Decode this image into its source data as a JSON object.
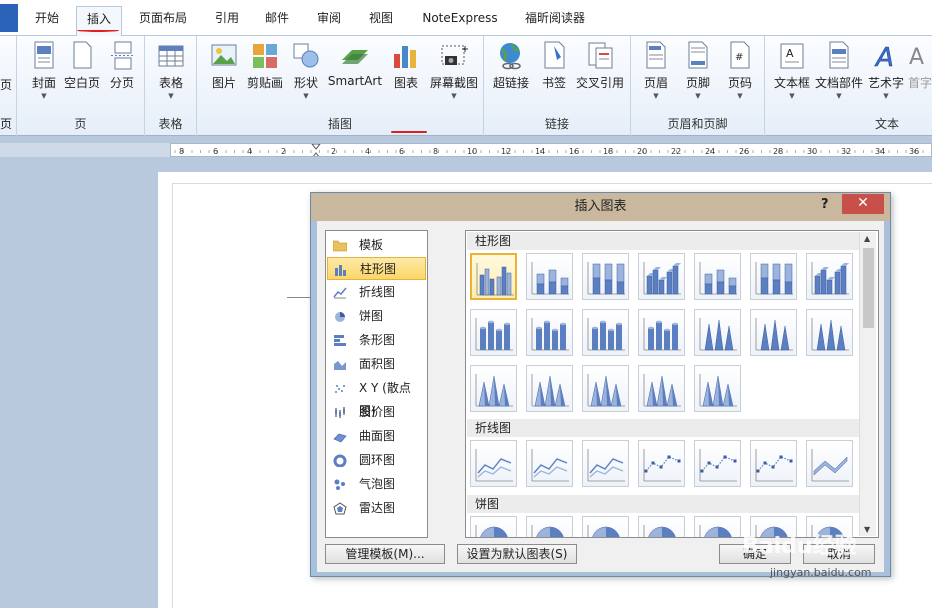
{
  "tabs": {
    "file_label": "",
    "items": [
      "开始",
      "插入",
      "页面布局",
      "引用",
      "邮件",
      "审阅",
      "视图",
      "NoteExpress",
      "福昕阅读器"
    ],
    "active": "插入"
  },
  "ribbon": {
    "left_edge_labels": [
      "页",
      "页"
    ],
    "groups": [
      {
        "label": "页",
        "buttons": [
          "封面",
          "空白页",
          "分页"
        ]
      },
      {
        "label": "表格",
        "buttons": [
          "表格"
        ]
      },
      {
        "label": "插图",
        "buttons": [
          "图片",
          "剪贴画",
          "形状",
          "SmartArt",
          "图表",
          "屏幕截图"
        ]
      },
      {
        "label": "链接",
        "buttons": [
          "超链接",
          "书签",
          "交叉引用"
        ]
      },
      {
        "label": "页眉和页脚",
        "buttons": [
          "页眉",
          "页脚",
          "页码"
        ]
      },
      {
        "label": "文本",
        "buttons": [
          "文本框",
          "文档部件",
          "艺术字",
          "首字"
        ]
      }
    ]
  },
  "ruler": {
    "ticks": [
      "8",
      "6",
      "4",
      "2",
      "2",
      "4",
      "6",
      "8",
      "10",
      "12",
      "14",
      "16",
      "18",
      "20",
      "22",
      "24",
      "26",
      "28",
      "30",
      "32",
      "34",
      "36"
    ]
  },
  "dialog": {
    "title": "插入图表",
    "help": "?",
    "close": "✕",
    "categories": [
      "模板",
      "柱形图",
      "折线图",
      "饼图",
      "条形图",
      "面积图",
      "X Y (散点图)",
      "股价图",
      "曲面图",
      "圆环图",
      "气泡图",
      "雷达图"
    ],
    "selected_category": "柱形图",
    "sections": [
      "柱形图",
      "折线图",
      "饼图"
    ],
    "buttons": {
      "manage": "管理模板(M)...",
      "set_default": "设置为默认图表(S)",
      "ok": "确定",
      "cancel": "取消"
    }
  },
  "watermark": {
    "text": "Baidu经验",
    "url": "jingyan.baidu.com"
  },
  "colors": {
    "accent": "#2a63b7",
    "highlight": "#e0201f",
    "selected": "#fbd768",
    "chart_blue": "#5b7fc1"
  }
}
